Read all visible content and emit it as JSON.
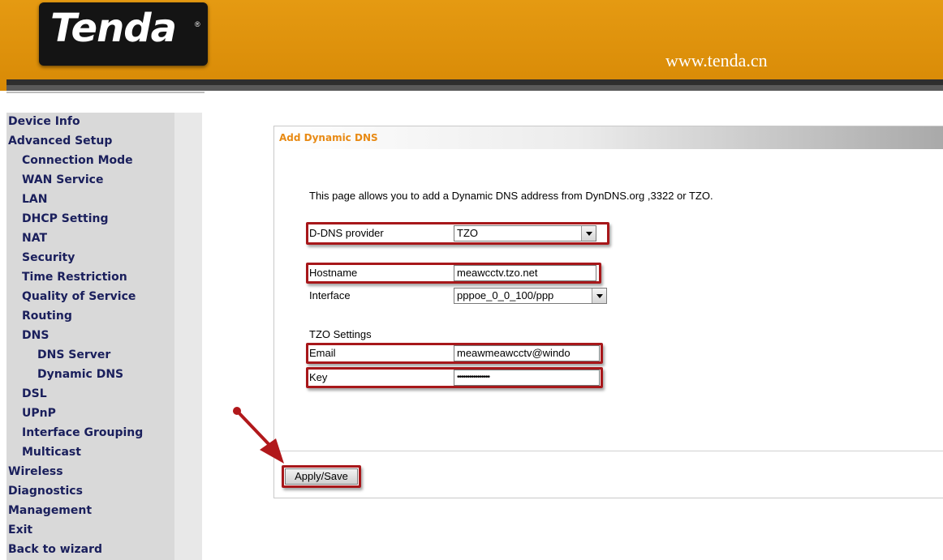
{
  "header": {
    "logo_text": "Tenda",
    "registered_mark": "®",
    "url": "www.tenda.cn",
    "brand_color": "#e0920c"
  },
  "sidebar": {
    "items": [
      {
        "label": "Device Info",
        "level": 0
      },
      {
        "label": "Advanced Setup",
        "level": 0
      },
      {
        "label": "Connection Mode",
        "level": 1
      },
      {
        "label": "WAN Service",
        "level": 1
      },
      {
        "label": "LAN",
        "level": 1
      },
      {
        "label": "DHCP Setting",
        "level": 1
      },
      {
        "label": "NAT",
        "level": 1
      },
      {
        "label": "Security",
        "level": 1
      },
      {
        "label": "Time Restriction",
        "level": 1
      },
      {
        "label": "Quality of Service",
        "level": 1
      },
      {
        "label": "Routing",
        "level": 1
      },
      {
        "label": "DNS",
        "level": 1
      },
      {
        "label": "DNS Server",
        "level": 2
      },
      {
        "label": "Dynamic DNS",
        "level": 2
      },
      {
        "label": "DSL",
        "level": 1
      },
      {
        "label": "UPnP",
        "level": 1
      },
      {
        "label": "Interface Grouping",
        "level": 1
      },
      {
        "label": "Multicast",
        "level": 1
      },
      {
        "label": "Wireless",
        "level": 0
      },
      {
        "label": "Diagnostics",
        "level": 0
      },
      {
        "label": "Management",
        "level": 0
      },
      {
        "label": "Exit",
        "level": 0
      },
      {
        "label": "Back to wizard",
        "level": 0
      }
    ]
  },
  "main": {
    "title": "Add Dynamic DNS",
    "description": "This page allows you to add a Dynamic DNS address from DynDNS.org ,3322 or TZO.",
    "provider": {
      "label": "D-DNS provider",
      "value": "TZO"
    },
    "hostname": {
      "label": "Hostname",
      "value": "meawcctv.tzo.net"
    },
    "interface": {
      "label": "Interface",
      "value": "pppoe_0_0_100/ppp"
    },
    "tzo_section": "TZO Settings",
    "email": {
      "label": "Email",
      "value": "meawmeawcctv@windo"
    },
    "key": {
      "label": "Key",
      "value": "••••••••••••••••"
    },
    "apply_label": "Apply/Save",
    "highlight_color": "#a7171a"
  }
}
